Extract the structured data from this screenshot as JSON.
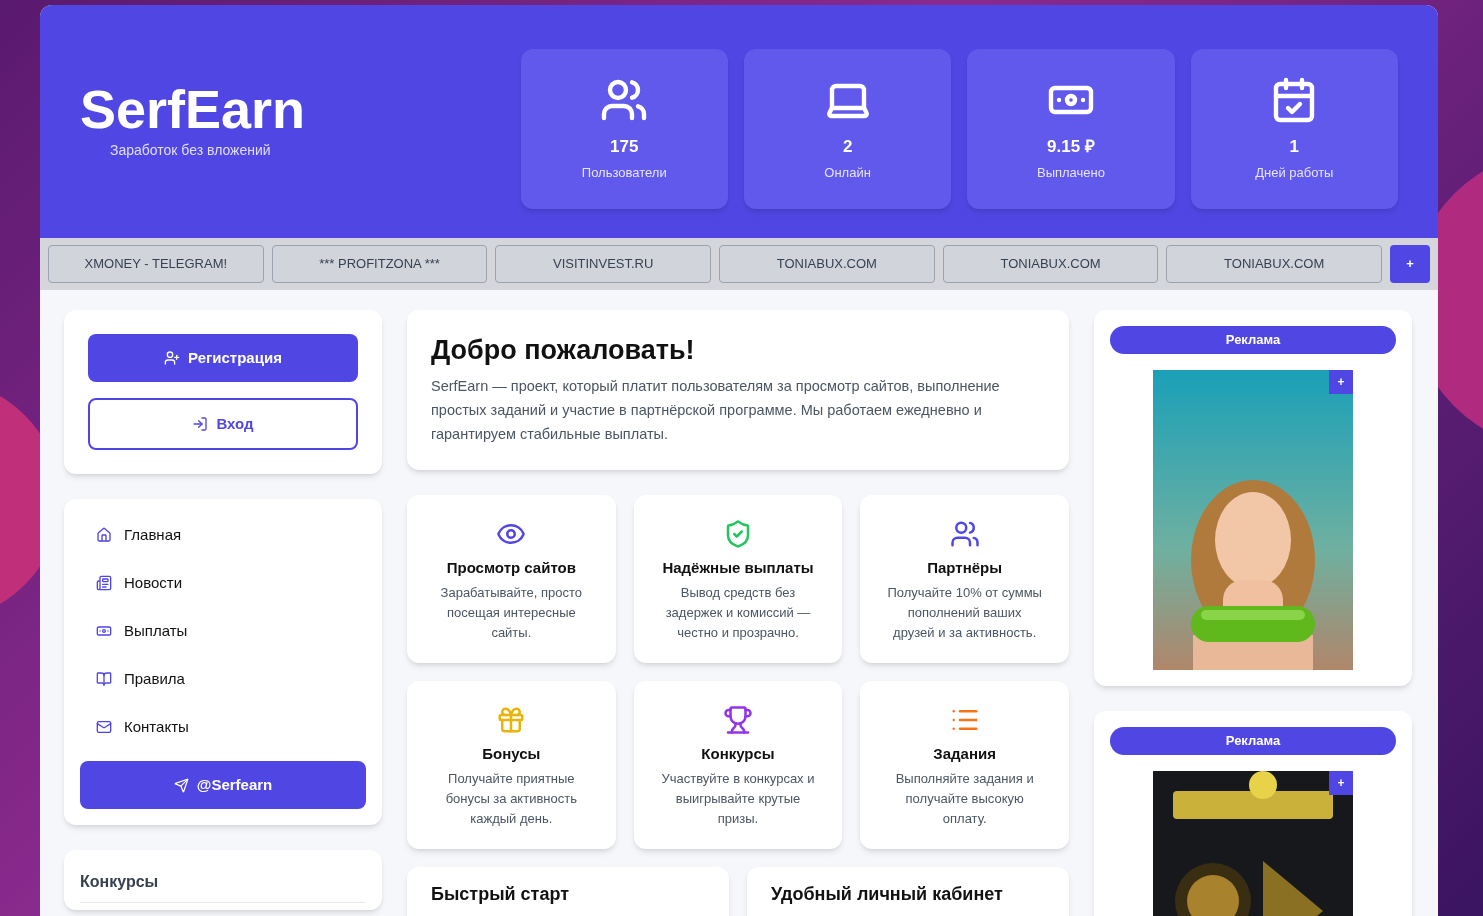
{
  "brand": {
    "name": "SerfEarn",
    "tagline": "Заработок без вложений"
  },
  "stats": [
    {
      "value": "175",
      "label": "Пользователи"
    },
    {
      "value": "2",
      "label": "Онлайн"
    },
    {
      "value": "9.15 ₽",
      "label": "Выплачено"
    },
    {
      "value": "1",
      "label": "Дней работы"
    }
  ],
  "links": [
    "XMONEY - TELEGRAM!",
    "*** PROFITZONA ***",
    "VISITINVEST.RU",
    "TONIABUX.COM",
    "TONIABUX.COM",
    "TONIABUX.COM"
  ],
  "links_add": "+",
  "auth": {
    "register": "Регистрация",
    "login": "Вход"
  },
  "menu": [
    "Главная",
    "Новости",
    "Выплаты",
    "Правила",
    "Контакты"
  ],
  "telegram": "@Serfearn",
  "contests_title": "Конкурсы",
  "welcome": {
    "title": "Добро пожаловать!",
    "text": "SerfEarn — проект, который платит пользователям за просмотр сайтов, выполнение простых заданий и участие в партнёрской программе. Мы работаем ежедневно и гарантируем стабильные выплаты."
  },
  "features": [
    {
      "title": "Просмотр сайтов",
      "text": "Зарабатывайте, просто посещая интересные сайты.",
      "color": "#4f46e5"
    },
    {
      "title": "Надёжные выплаты",
      "text": "Вывод средств без задержек и комиссий — честно и прозрачно.",
      "color": "#22c55e"
    },
    {
      "title": "Партнёры",
      "text": "Получайте 10% от суммы пополнений ваших друзей и за активность.",
      "color": "#4f46e5"
    },
    {
      "title": "Бонусы",
      "text": "Получайте приятные бонусы за активность каждый день.",
      "color": "#eab308"
    },
    {
      "title": "Конкурсы",
      "text": "Участвуйте в конкурсах и выигрывайте крутые призы.",
      "color": "#9333ea"
    },
    {
      "title": "Задания",
      "text": "Выполняйте задания и получайте высокую оплату.",
      "color": "#f97316"
    }
  ],
  "bottom_cards": [
    "Быстрый старт",
    "Удобный личный кабинет"
  ],
  "ads": [
    {
      "title": "Реклама",
      "add": "+",
      "kind": "picture"
    },
    {
      "title": "Реклама",
      "add": "+",
      "kind": "picture"
    }
  ]
}
